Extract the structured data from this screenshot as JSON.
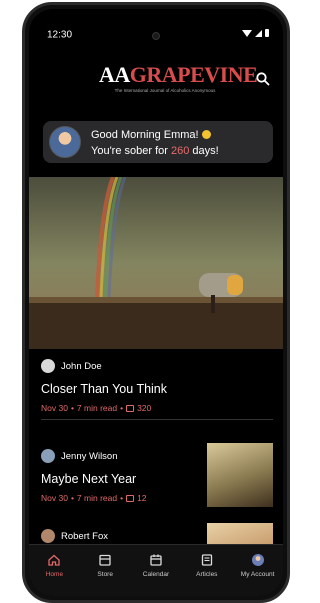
{
  "status_bar": {
    "time": "12:30"
  },
  "header": {
    "logo_part1": "AA",
    "logo_part2": "GRAPEVINE",
    "logo_subtitle": "The International Journal of Alcoholics Anonymous",
    "search_icon": "search-icon"
  },
  "greeting": {
    "line1": "Good Morning Emma!",
    "line2_prefix": "You're sober for ",
    "days": "260",
    "line2_suffix": " days!"
  },
  "posts": [
    {
      "author": "John Doe",
      "title": "Closer Than You Think",
      "date": "Nov 30",
      "read_time": "7 min read",
      "comments": "320"
    },
    {
      "author": "Jenny Wilson",
      "title": "Maybe Next Year",
      "date": "Nov 30",
      "read_time": "7 min read",
      "comments": "12"
    },
    {
      "author": "Robert Fox"
    }
  ],
  "tabs": [
    {
      "label": "Home",
      "icon": "home-icon",
      "active": true
    },
    {
      "label": "Store",
      "icon": "store-icon",
      "active": false
    },
    {
      "label": "Calendar",
      "icon": "calendar-icon",
      "active": false
    },
    {
      "label": "Articles",
      "icon": "articles-icon",
      "active": false
    },
    {
      "label": "My Account",
      "icon": "account-icon",
      "active": false
    }
  ],
  "colors": {
    "accent": "#e06a6a",
    "background": "#000000",
    "card": "#2a2a2c"
  },
  "separator": " • "
}
